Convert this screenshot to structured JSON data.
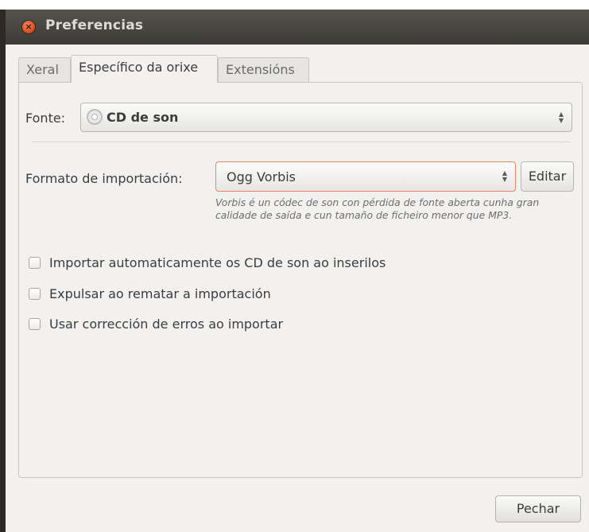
{
  "window": {
    "title": "Preferencias",
    "close_glyph": "×"
  },
  "tabs": [
    {
      "label": "Xeral",
      "active": false
    },
    {
      "label": "Específico da orixe",
      "active": true
    },
    {
      "label": "Extensións",
      "active": false
    }
  ],
  "source": {
    "label": "Fonte:",
    "value": "CD de son",
    "icon": "cd-icon"
  },
  "import_format": {
    "label": "Formato de importación:",
    "value": "Ogg Vorbis",
    "edit_label": "Editar",
    "description": "Vorbis é un códec de son con pérdida de fonte aberta cunha gran calidade de saída e cun tamaño de ficheiro menor que MP3."
  },
  "options": [
    {
      "label": "Importar automaticamente os CD de son ao inserilos",
      "checked": false
    },
    {
      "label": "Expulsar ao rematar a importación",
      "checked": false
    },
    {
      "label": "Usar corrección de erros ao importar",
      "checked": false
    }
  ],
  "footer": {
    "close_label": "Pechar"
  },
  "colors": {
    "titlebar": "#3c3b37",
    "title_text": "#dfdbd2",
    "close_button": "#dd4814",
    "focus_border": "#e9846a",
    "window_bg": "#f2f1f0"
  }
}
